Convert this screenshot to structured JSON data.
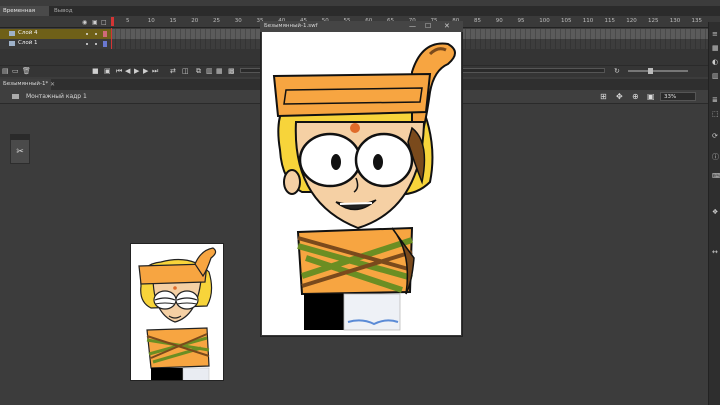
{
  "timeline": {
    "tab_timeline": "Временная шкала",
    "tab_output": "Вывод",
    "frame_numbers": [
      "5",
      "10",
      "15",
      "20",
      "25",
      "30",
      "35",
      "40",
      "45",
      "50",
      "55",
      "60",
      "65",
      "70",
      "75",
      "80",
      "85",
      "90",
      "95",
      "100",
      "105",
      "110",
      "115",
      "120",
      "125",
      "130",
      "135"
    ],
    "layers": [
      {
        "name": "Слой 4",
        "selected": true,
        "color": "#d06a78"
      },
      {
        "name": "Слой 1",
        "selected": false,
        "color": "#6a78d0"
      }
    ]
  },
  "document": {
    "tab_label": "Безымянный-1*",
    "close_glyph": "✕",
    "scene_label": "Монтажный кадр 1",
    "zoom": "33%"
  },
  "swf_window": {
    "title": "Безымянный-1.swf",
    "min_glyph": "—",
    "max_glyph": "☐",
    "close_glyph": "✕"
  },
  "icons": {
    "tool": "scissors-icon",
    "scene": "clapper-icon"
  },
  "colors": {
    "accent_orange": "#f7a541",
    "hair_yellow": "#f7d43a",
    "skin": "#f5d0a4",
    "green_stripe": "#6b8e23",
    "brown": "#7a4a1c",
    "playhead": "#d43535"
  }
}
